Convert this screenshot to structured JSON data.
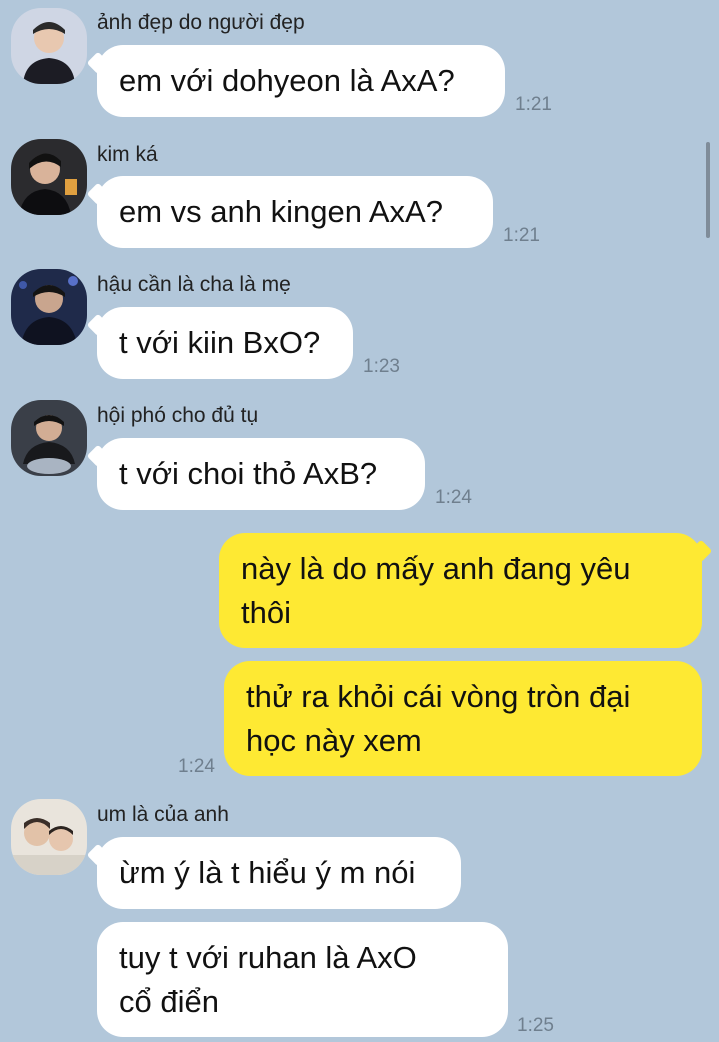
{
  "messages": [
    {
      "sender": "ảnh đẹp do người đẹp",
      "text": "em với dohyeon là AxA?",
      "time": "1:21"
    },
    {
      "sender": "kim ká",
      "text": "em vs anh kingen AxA?",
      "time": "1:21"
    },
    {
      "sender": "hậu cần là cha là mẹ",
      "text": "t với kiin BxO?",
      "time": "1:23"
    },
    {
      "sender": "hội phó cho đủ tụ",
      "text": "t với choi thỏ AxB?",
      "time": "1:24"
    },
    {
      "mine": true,
      "text": "này là do mấy anh đang yêu\nthôi"
    },
    {
      "mine": true,
      "text": "thử ra khỏi cái vòng tròn đại\nhọc này xem",
      "time": "1:24"
    },
    {
      "sender": "um là của anh",
      "text": "ừm ý là t hiểu ý m nói"
    },
    {
      "text": "tuy t với ruhan là AxO\ncổ điển",
      "time": "1:25"
    }
  ],
  "colors": {
    "background": "#b2c7da",
    "incoming_bubble": "#ffffff",
    "outgoing_bubble": "#fee933"
  },
  "icons": [
    "avatar-1",
    "avatar-2",
    "avatar-3",
    "avatar-4",
    "avatar-5"
  ]
}
